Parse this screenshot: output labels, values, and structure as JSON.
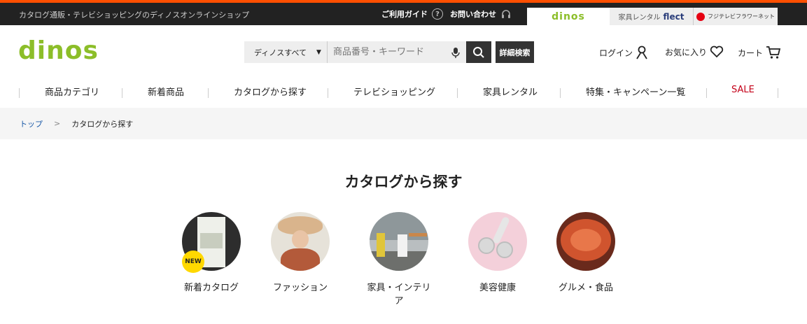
{
  "topbar": {
    "tagline": "カタログ通販・テレビショッピングのディノスオンラインショップ",
    "guide": "ご利用ガイド",
    "contact": "お問い合わせ",
    "site_tabs": [
      "dinos",
      "家具レンタル",
      "flect",
      "フジテレビフラワーネット"
    ]
  },
  "header": {
    "logo": "dinos",
    "search_scope": "ディノスすべて",
    "search_placeholder": "商品番号・キーワード",
    "advanced_search": "詳細検索",
    "login": "ログイン",
    "favorites": "お気に入り",
    "cart": "カート"
  },
  "nav": {
    "items": [
      "商品カテゴリ",
      "新着商品",
      "カタログから探す",
      "テレビショッピング",
      "家具レンタル",
      "特集・キャンペーン一覧",
      "SALE"
    ]
  },
  "breadcrumb": {
    "top": "トップ",
    "sep": ">",
    "current": "カタログから探す"
  },
  "main": {
    "title": "カタログから探す",
    "new_badge": "NEW",
    "categories": [
      "新着カタログ",
      "ファッション",
      "家具・インテリア",
      "美容健康",
      "グルメ・食品"
    ]
  },
  "colors": {
    "accent": "#ff4f00",
    "brand": "#8cbe29",
    "sale": "#c40018",
    "link": "#1b5aa8"
  }
}
